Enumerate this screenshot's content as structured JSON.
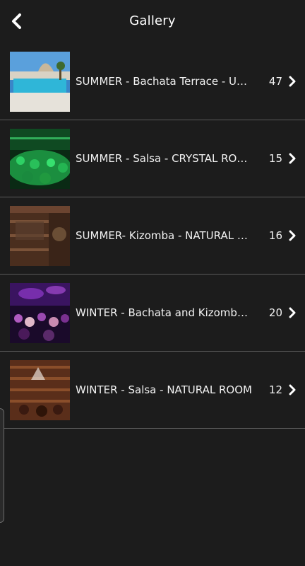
{
  "header": {
    "title": "Gallery",
    "back_icon": "chevron-left-icon"
  },
  "albums": [
    {
      "label": "SUMMER - Bachata Terrace - UR...",
      "count": "47",
      "logo": "JOWE"
    },
    {
      "label": "SUMMER - Salsa - CRYSTAL ROOM",
      "count": "15",
      "logo": "JOWE"
    },
    {
      "label": "SUMMER- Kizomba - NATURAL R...",
      "count": "16",
      "logo": "JOWE"
    },
    {
      "label": "WINTER - Bachata and Kizomba -...",
      "count": "20",
      "logo": "JOWE"
    },
    {
      "label": "WINTER - Salsa - NATURAL ROOM",
      "count": "12",
      "logo": "JOWE"
    }
  ],
  "colors": {
    "background": "#1c1c1c",
    "divider": "#5a5a5a",
    "text": "#ffffff"
  }
}
